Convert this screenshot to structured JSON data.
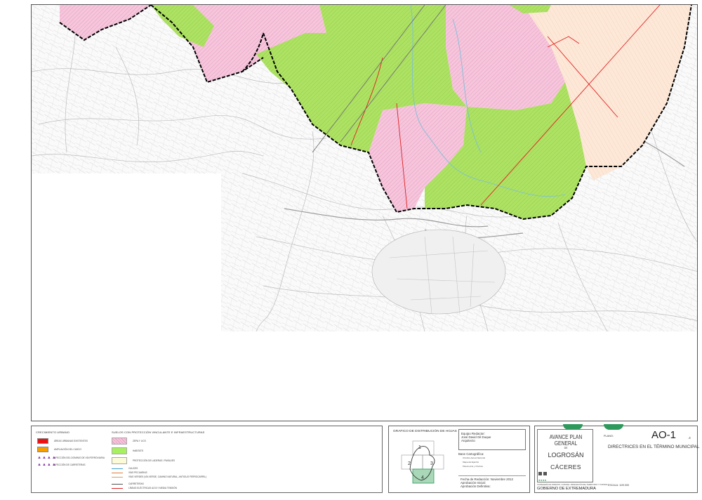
{
  "map": {
    "colors": {
      "pink_protected": "#f5c6dc",
      "green_zone": "#a8e060",
      "peach_zone": "#fde8d8",
      "boundary": "#000000",
      "power_line": "#e02020"
    }
  },
  "legend": {
    "urban": {
      "heading": "CRECIMIENTO URBANO",
      "items": [
        {
          "label": "ÁREAS URBANAS EXISTENTES",
          "color": "#ee1111",
          "kind": "swatch"
        },
        {
          "label": "AMPLIACIÓN DEL CASCO",
          "color": "#f5a000",
          "kind": "swatch"
        },
        {
          "label": "AFECCIÓN DEL DOMINIO DE VÍA FERROVIARIA",
          "color": "#8a3aa8",
          "kind": "triangles"
        },
        {
          "label": "AFECCIÓN DE CARRETERAS",
          "color": "#8a3aa8",
          "kind": "triangles"
        }
      ]
    },
    "protection": {
      "heading": "SUELOS CON PROTECCIÓN VINCULANTE E INFRAESTRUCTURAS",
      "items": [
        {
          "label": "ZEPA Y LICS",
          "color": "#f5c6dc",
          "kind": "swatch"
        },
        {
          "label": "HABITATS",
          "color": "#a8f060",
          "kind": "swatch"
        },
        {
          "label": "PROTECCIÓN DE LADERAS / PAISAJES",
          "color": "#fbfbd8",
          "kind": "swatch"
        }
      ]
    },
    "lines": [
      {
        "label": "CAUCES",
        "color": "#3aa0d0"
      },
      {
        "label": "VÍAS PECUARIAS",
        "color": "#e07a30"
      },
      {
        "label": "VÍAS VERDES (VÍA VERDE, CAMINO NATURAL, ANTIGUO FERROCARRIL)",
        "color": "#d4a060"
      },
      {
        "label": "CARRETERAS",
        "color": "#555555"
      },
      {
        "label": "LÍNEAS ELÉCTRICAS ALTA Y MEDIA TENSIÓN",
        "color": "#e02020"
      }
    ]
  },
  "sheets": {
    "title": "GRAFICO DE DISTRIBUCIÓN DE HOJAS",
    "numbers": [
      "1",
      "2",
      "3",
      "4"
    ],
    "active_sheet": "4"
  },
  "team": {
    "heading": "Equipo Redactor:",
    "name": "José David Gil Duque",
    "role": "Arquitecto"
  },
  "base": {
    "heading": "Base Cartográfica:",
    "items": [
      "Ortofoto Aérea Nacional",
      "Mapa del Ejército",
      "Planimetría y Ortofoto"
    ]
  },
  "dates": {
    "redaction": "Fecha de Redacción: Noviembre 2012",
    "initial": "Aprobación Inicial:",
    "final": "Aprobación Definitiva:"
  },
  "title_block": {
    "line1": "AVANCE PLAN GENERAL",
    "de": "DE",
    "town": "LOGROSÁN",
    "province": "CÁCERES",
    "plano_label": "PLANO:",
    "code": "AO-1",
    "code_sub": ".4",
    "description": "DIRECTRICES EN EL TÉRMINO MUNICIPAL",
    "consejeria": "CONSEJERÍA DE FOMENTO, VIVIENDA, ORDENACIÓN DEL TERRITORIO Y TURISMO",
    "gobierno": "GOBIERNO DE EXTREMADURA",
    "scale": "ESCALA: 1/20.000",
    "accent": "#2d9a5b"
  }
}
